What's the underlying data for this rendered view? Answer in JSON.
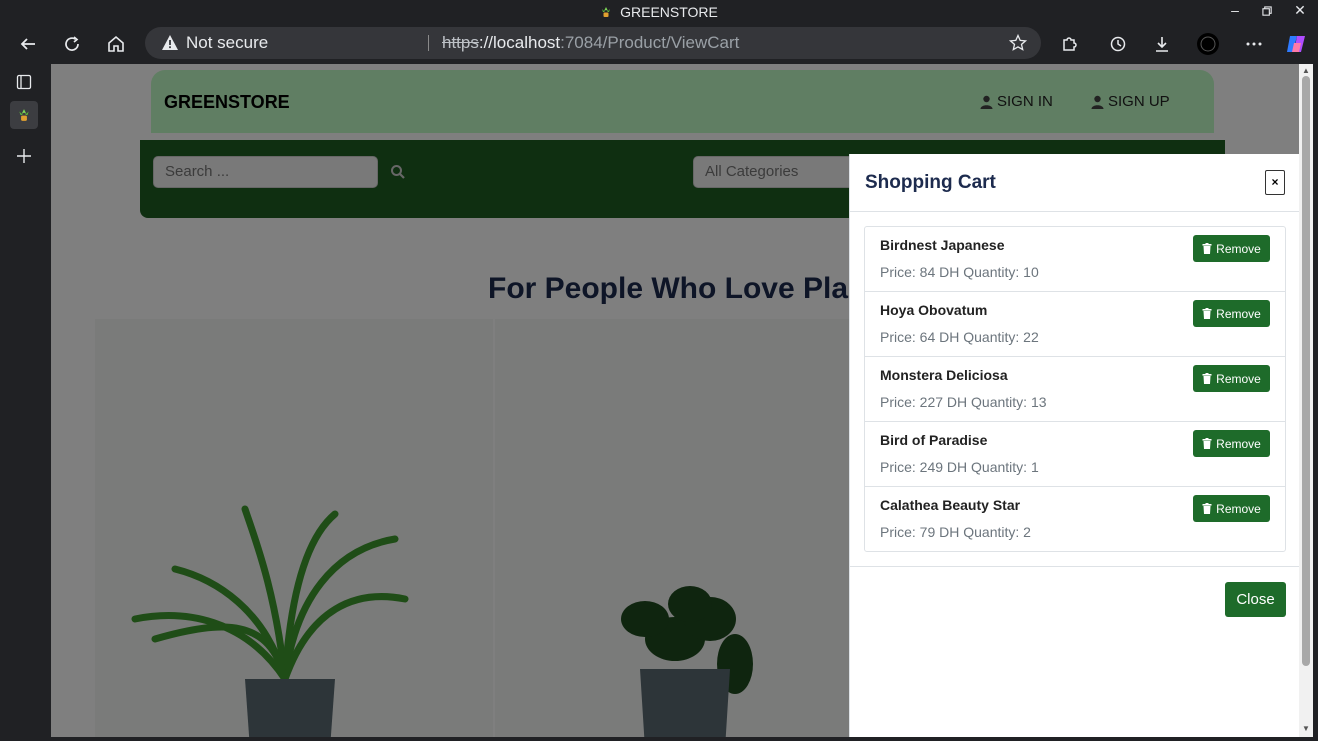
{
  "window": {
    "title": "GREENSTORE"
  },
  "browser": {
    "security_label": "Not secure",
    "url_scheme": "https",
    "url_host": "://localhost",
    "url_path": ":7084/Product/ViewCart"
  },
  "site": {
    "brand": "GREENSTORE",
    "nav": {
      "sign_in": "SIGN IN",
      "sign_up": "SIGN UP"
    },
    "search": {
      "placeholder": "Search ..."
    },
    "category_select": {
      "value": "All Categories"
    },
    "hero_title": "For People Who Love Plan"
  },
  "cart": {
    "title": "Shopping Cart",
    "close_x": "×",
    "remove_label": "Remove",
    "close_label": "Close",
    "items": [
      {
        "name": "Birdnest Japanese",
        "meta": "Price: 84 DH Quantity: 10"
      },
      {
        "name": "Hoya Obovatum",
        "meta": "Price: 64 DH Quantity: 22"
      },
      {
        "name": "Monstera Deliciosa",
        "meta": "Price: 227 DH Quantity: 13"
      },
      {
        "name": "Bird of Paradise",
        "meta": "Price: 249 DH Quantity: 1"
      },
      {
        "name": "Calathea Beauty Star",
        "meta": "Price: 79 DH Quantity: 2"
      }
    ]
  },
  "colors": {
    "navbar_bg": "#c1fcc7",
    "search_band_bg": "#1f5e23",
    "button_green": "#1e6b2a",
    "heading_navy": "#1d2b4e"
  },
  "icons": {
    "favicon": "plant-icon",
    "back": "back-arrow-icon",
    "reload": "reload-icon",
    "home": "home-icon",
    "warning": "warning-icon",
    "favorite": "star-icon",
    "extensions": "puzzle-icon",
    "history": "history-icon",
    "downloads": "download-icon",
    "profile": "avatar",
    "more": "more-icon",
    "copilot": "copilot-icon",
    "user": "user-icon",
    "search": "search-icon",
    "trash": "trash-icon"
  }
}
